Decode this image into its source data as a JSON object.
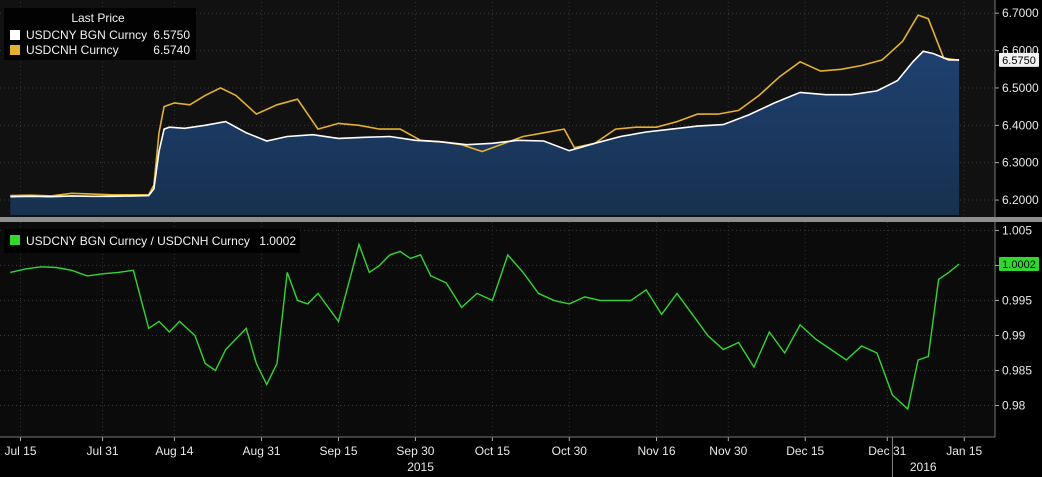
{
  "chart_data": [
    {
      "type": "area",
      "legend_title": "Last Price",
      "legend_placement": "top-left",
      "grid": true,
      "ylim": [
        6.16,
        6.73
      ],
      "yticks": [
        6.2,
        6.3,
        6.4,
        6.5,
        6.6,
        6.7
      ],
      "ytick_labels": [
        "6.2000",
        "6.3000",
        "6.4000",
        "6.5000",
        "6.6000",
        "6.7000"
      ],
      "series": [
        {
          "name": "USDCNY BGN Curncy",
          "legend_value": "6.5750",
          "badge_value": "6.5750",
          "color": "#ffffff",
          "fill": "#1c3a63",
          "x": [
            "2015-07-13",
            "2015-07-17",
            "2015-07-21",
            "2015-07-25",
            "2015-07-29",
            "2015-08-02",
            "2015-08-06",
            "2015-08-09",
            "2015-08-10",
            "2015-08-11",
            "2015-08-12",
            "2015-08-13",
            "2015-08-16",
            "2015-08-20",
            "2015-08-24",
            "2015-08-28",
            "2015-09-01",
            "2015-09-05",
            "2015-09-10",
            "2015-09-15",
            "2015-09-20",
            "2015-09-25",
            "2015-09-30",
            "2015-10-05",
            "2015-10-10",
            "2015-10-15",
            "2015-10-20",
            "2015-10-25",
            "2015-10-30",
            "2015-11-04",
            "2015-11-09",
            "2015-11-14",
            "2015-11-19",
            "2015-11-24",
            "2015-11-29",
            "2015-12-04",
            "2015-12-09",
            "2015-12-14",
            "2015-12-19",
            "2015-12-24",
            "2015-12-29",
            "2016-01-02",
            "2016-01-05",
            "2016-01-07",
            "2016-01-09",
            "2016-01-12",
            "2016-01-14"
          ],
          "values": [
            6.209,
            6.21,
            6.209,
            6.211,
            6.21,
            6.21,
            6.211,
            6.212,
            6.23,
            6.33,
            6.39,
            6.395,
            6.392,
            6.4,
            6.41,
            6.38,
            6.358,
            6.37,
            6.375,
            6.365,
            6.368,
            6.37,
            6.36,
            6.356,
            6.348,
            6.352,
            6.36,
            6.358,
            6.332,
            6.352,
            6.37,
            6.382,
            6.39,
            6.398,
            6.402,
            6.428,
            6.46,
            6.488,
            6.482,
            6.482,
            6.492,
            6.52,
            6.57,
            6.598,
            6.592,
            6.575,
            6.575
          ]
        },
        {
          "name": "USDCNH Curncy",
          "legend_value": "6.5740",
          "color": "#e3b12b",
          "x": [
            "2015-07-13",
            "2015-07-17",
            "2015-07-21",
            "2015-07-25",
            "2015-07-29",
            "2015-08-02",
            "2015-08-06",
            "2015-08-09",
            "2015-08-10",
            "2015-08-11",
            "2015-08-12",
            "2015-08-14",
            "2015-08-17",
            "2015-08-20",
            "2015-08-23",
            "2015-08-26",
            "2015-08-30",
            "2015-09-03",
            "2015-09-07",
            "2015-09-11",
            "2015-09-15",
            "2015-09-19",
            "2015-09-23",
            "2015-09-27",
            "2015-10-01",
            "2015-10-05",
            "2015-10-09",
            "2015-10-13",
            "2015-10-17",
            "2015-10-21",
            "2015-10-25",
            "2015-10-29",
            "2015-10-31",
            "2015-11-04",
            "2015-11-08",
            "2015-11-12",
            "2015-11-16",
            "2015-11-20",
            "2015-11-24",
            "2015-11-28",
            "2015-12-02",
            "2015-12-06",
            "2015-12-10",
            "2015-12-14",
            "2015-12-18",
            "2015-12-22",
            "2015-12-26",
            "2015-12-30",
            "2016-01-03",
            "2016-01-06",
            "2016-01-08",
            "2016-01-11",
            "2016-01-14"
          ],
          "values": [
            6.212,
            6.213,
            6.211,
            6.218,
            6.216,
            6.214,
            6.214,
            6.214,
            6.24,
            6.38,
            6.45,
            6.46,
            6.455,
            6.48,
            6.5,
            6.48,
            6.43,
            6.455,
            6.47,
            6.39,
            6.405,
            6.4,
            6.39,
            6.39,
            6.36,
            6.356,
            6.348,
            6.33,
            6.35,
            6.37,
            6.38,
            6.39,
            6.34,
            6.352,
            6.39,
            6.395,
            6.395,
            6.41,
            6.43,
            6.43,
            6.44,
            6.48,
            6.53,
            6.57,
            6.545,
            6.55,
            6.56,
            6.575,
            6.625,
            6.695,
            6.685,
            6.58,
            6.574
          ]
        }
      ]
    },
    {
      "type": "line",
      "grid": true,
      "ylim": [
        0.9755,
        1.0062
      ],
      "yticks": [
        0.98,
        0.985,
        0.99,
        0.995,
        1.0,
        1.005
      ],
      "ytick_labels": [
        "0.98",
        "0.985",
        "0.99",
        "0.995",
        "",
        "1.005"
      ],
      "series": [
        {
          "name": "USDCNY BGN Curncy / USDCNH Curncy",
          "legend_value": "1.0002",
          "badge_value": "1.0002",
          "color": "#2fd82f",
          "x": [
            "2015-07-13",
            "2015-07-16",
            "2015-07-19",
            "2015-07-22",
            "2015-07-25",
            "2015-07-28",
            "2015-07-31",
            "2015-08-03",
            "2015-08-06",
            "2015-08-09",
            "2015-08-11",
            "2015-08-13",
            "2015-08-15",
            "2015-08-18",
            "2015-08-20",
            "2015-08-22",
            "2015-08-24",
            "2015-08-26",
            "2015-08-28",
            "2015-08-30",
            "2015-09-01",
            "2015-09-03",
            "2015-09-05",
            "2015-09-07",
            "2015-09-09",
            "2015-09-11",
            "2015-09-13",
            "2015-09-15",
            "2015-09-17",
            "2015-09-19",
            "2015-09-21",
            "2015-09-23",
            "2015-09-25",
            "2015-09-27",
            "2015-09-29",
            "2015-10-01",
            "2015-10-03",
            "2015-10-06",
            "2015-10-09",
            "2015-10-12",
            "2015-10-15",
            "2015-10-18",
            "2015-10-21",
            "2015-10-24",
            "2015-10-27",
            "2015-10-30",
            "2015-11-02",
            "2015-11-05",
            "2015-11-08",
            "2015-11-11",
            "2015-11-14",
            "2015-11-17",
            "2015-11-20",
            "2015-11-23",
            "2015-11-26",
            "2015-11-29",
            "2015-12-02",
            "2015-12-05",
            "2015-12-08",
            "2015-12-11",
            "2015-12-14",
            "2015-12-17",
            "2015-12-20",
            "2015-12-23",
            "2015-12-26",
            "2015-12-29",
            "2016-01-01",
            "2016-01-04",
            "2016-01-06",
            "2016-01-08",
            "2016-01-10",
            "2016-01-12",
            "2016-01-14"
          ],
          "values": [
            0.999,
            0.9995,
            0.9998,
            0.9997,
            0.9993,
            0.9985,
            0.9988,
            0.999,
            0.9993,
            0.991,
            0.992,
            0.9905,
            0.992,
            0.99,
            0.986,
            0.985,
            0.988,
            0.9895,
            0.991,
            0.986,
            0.983,
            0.986,
            0.999,
            0.995,
            0.9945,
            0.996,
            0.994,
            0.992,
            0.9975,
            1.003,
            0.999,
            1.0,
            1.0015,
            1.002,
            1.001,
            1.0015,
            0.9985,
            0.9975,
            0.994,
            0.996,
            0.995,
            1.0015,
            0.999,
            0.996,
            0.995,
            0.9945,
            0.9955,
            0.995,
            0.995,
            0.995,
            0.9965,
            0.993,
            0.996,
            0.993,
            0.99,
            0.988,
            0.989,
            0.9855,
            0.9905,
            0.9875,
            0.9915,
            0.9895,
            0.988,
            0.9865,
            0.9885,
            0.9875,
            0.9815,
            0.9795,
            0.9865,
            0.987,
            0.998,
            0.999,
            1.0002
          ]
        }
      ]
    }
  ],
  "xaxis": {
    "range": [
      "2015-07-11",
      "2016-01-21"
    ],
    "ticks": [
      {
        "date": "2015-07-15",
        "label": "Jul 15"
      },
      {
        "date": "2015-07-31",
        "label": "Jul 31"
      },
      {
        "date": "2015-08-14",
        "label": "Aug 14"
      },
      {
        "date": "2015-08-31",
        "label": "Aug 31"
      },
      {
        "date": "2015-09-15",
        "label": "Sep 15"
      },
      {
        "date": "2015-09-30",
        "label": "Sep 30"
      },
      {
        "date": "2015-10-15",
        "label": "Oct 15"
      },
      {
        "date": "2015-10-30",
        "label": "Oct 30"
      },
      {
        "date": "2015-11-16",
        "label": "Nov 16"
      },
      {
        "date": "2015-11-30",
        "label": "Nov 30"
      },
      {
        "date": "2015-12-15",
        "label": "Dec 15"
      },
      {
        "date": "2015-12-31",
        "label": "Dec 31"
      },
      {
        "date": "2016-01-15",
        "label": "Jan 15"
      }
    ],
    "year_labels": [
      {
        "date": "2015-10-01",
        "label": "2015"
      },
      {
        "date": "2016-01-07",
        "label": "2016"
      }
    ],
    "year_break": "2016-01-01"
  }
}
